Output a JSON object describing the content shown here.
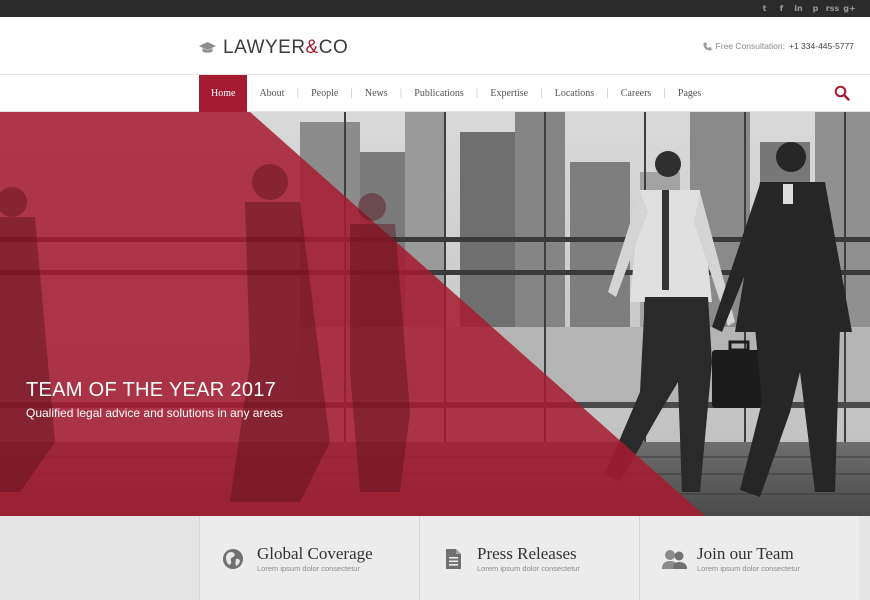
{
  "social": {
    "icons": [
      "twitter-icon",
      "facebook-icon",
      "linkedin-icon",
      "pinterest-icon",
      "rss-icon",
      "google-plus-icon"
    ],
    "glyphs": [
      "t",
      "f",
      "in",
      "p",
      "rss",
      "g+"
    ]
  },
  "brand": {
    "name_left": "LAWYER",
    "amp": "&",
    "name_right": "CO",
    "accent": "#a51c30"
  },
  "header": {
    "consult_label": "Free Consultation:",
    "consult_number": "+1 334-445-5777"
  },
  "nav": {
    "items": [
      "Home",
      "About",
      "People",
      "News",
      "Publications",
      "Expertise",
      "Locations",
      "Careers",
      "Pages"
    ],
    "active": "Home",
    "separator": "|"
  },
  "hero": {
    "title": "TEAM OF THE YEAR 2017",
    "subtitle": "Qualified legal advice and solutions in any areas"
  },
  "features": [
    {
      "title": "Global Coverage",
      "desc": "Lorem ipsum dolor consectetur",
      "icon": "globe-icon"
    },
    {
      "title": "Press Releases",
      "desc": "Lorem ipsum dolor consectetur",
      "icon": "document-icon"
    },
    {
      "title": "Join our Team",
      "desc": "Lorem ipsum dolor consectetur",
      "icon": "team-icon"
    }
  ]
}
